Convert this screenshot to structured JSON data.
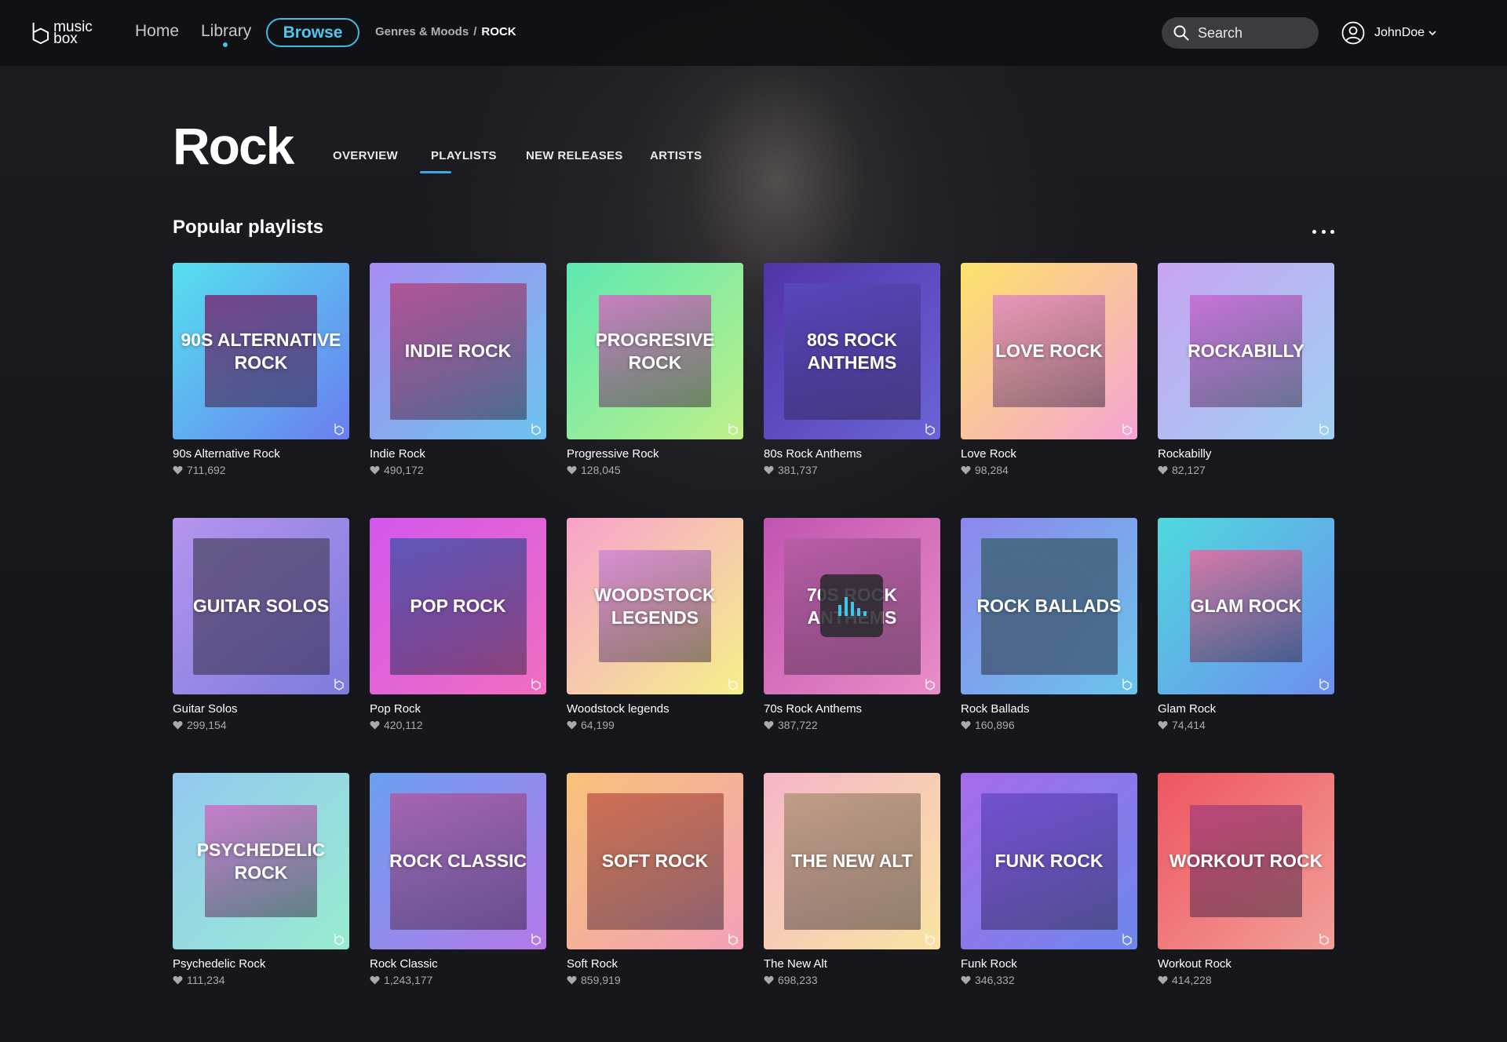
{
  "app": {
    "logo_text": "music box"
  },
  "nav": {
    "home": "Home",
    "library": "Library",
    "browse": "Browse"
  },
  "breadcrumb": {
    "parent": "Genres & Moods",
    "separator": "/",
    "current": "ROCK"
  },
  "search": {
    "placeholder": "Search"
  },
  "user": {
    "name": "JohnDoe"
  },
  "page": {
    "title": "Rock"
  },
  "tabs": [
    "OVERVIEW",
    "PLAYLISTS",
    "NEW RELEASES",
    "ARTISTS"
  ],
  "active_tab": "PLAYLISTS",
  "section": {
    "title": "Popular playlists"
  },
  "colors": {
    "accent": "#3fb9e6",
    "background": "#15171b"
  },
  "playlists": [
    {
      "name": "90s Alternative Rock",
      "cover_title": "90s ALTERNATIVE ROCK",
      "likes": "711,692",
      "grad": [
        "#56e0ef",
        "#6a7ef0"
      ],
      "photo": "#7a2a78"
    },
    {
      "name": "Indie Rock",
      "cover_title": "INDIE ROCK",
      "likes": "490,172",
      "grad": [
        "#a78cf2",
        "#6cc3ef"
      ],
      "photo": "#b44a86"
    },
    {
      "name": "Progressive Rock",
      "cover_title": "PROGRESIVE ROCK",
      "likes": "128,045",
      "grad": [
        "#5de8b0",
        "#bff08a"
      ],
      "photo": "#d96cc6"
    },
    {
      "name": "80s Rock Anthems",
      "cover_title": "80s ROCK ANTHEMS",
      "likes": "381,737",
      "grad": [
        "#5233a8",
        "#6a64d8"
      ],
      "photo": "#5a4ac0"
    },
    {
      "name": "Love Rock",
      "cover_title": "LOVE ROCK",
      "likes": "98,284",
      "grad": [
        "#fde36a",
        "#f5a3d4"
      ],
      "photo": "#e88ac6"
    },
    {
      "name": "Rockabilly",
      "cover_title": "ROCKABILLY",
      "likes": "82,127",
      "grad": [
        "#c8a4f2",
        "#9fd0f2"
      ],
      "photo": "#c66ad4"
    },
    {
      "name": "Guitar Solos",
      "cover_title": "GUITAR SOLOS",
      "likes": "299,154",
      "grad": [
        "#b594ee",
        "#7d7cdc"
      ],
      "photo": "#5b4e78"
    },
    {
      "name": "Pop Rock",
      "cover_title": "POP ROCK",
      "likes": "420,112",
      "grad": [
        "#d357ec",
        "#f06ec0"
      ],
      "photo": "#4b56b0"
    },
    {
      "name": "Woodstock legends",
      "cover_title": "WOODSTOCK LEGENDS",
      "likes": "64,199",
      "grad": [
        "#f8a2cc",
        "#f5f08a"
      ],
      "photo": "#d28ad4"
    },
    {
      "name": "70s Rock Anthems",
      "cover_title": "70s ROCK ANTHEMS",
      "likes": "387,722",
      "grad": [
        "#c154b0",
        "#e98dc8"
      ],
      "photo": "#b75ea6"
    },
    {
      "name": "Rock Ballads",
      "cover_title": "ROCK BALLADS",
      "likes": "160,896",
      "grad": [
        "#8d86ec",
        "#6ac4ec"
      ],
      "photo": "#3e6878"
    },
    {
      "name": "Glam Rock",
      "cover_title": "GLAM ROCK",
      "likes": "74,414",
      "grad": [
        "#4fd9dd",
        "#6f8ef0"
      ],
      "photo": "#ec6aa2"
    },
    {
      "name": "Psychedelic Rock",
      "cover_title": "PSYCHEDELIC ROCK",
      "likes": "111,234",
      "grad": [
        "#94c8f0",
        "#98ecd0"
      ],
      "photo": "#d070c6"
    },
    {
      "name": "Rock Classic",
      "cover_title": "ROCK CLASSIC",
      "likes": "1,243,177",
      "grad": [
        "#6aa0f0",
        "#b678e8"
      ],
      "photo": "#b15aa6"
    },
    {
      "name": "Soft Rock",
      "cover_title": "SOFT ROCK",
      "likes": "859,919",
      "grad": [
        "#f8c27a",
        "#f3a0b6"
      ],
      "photo": "#c8604c"
    },
    {
      "name": "The New Alt",
      "cover_title": "THE NEW ALT",
      "likes": "698,233",
      "grad": [
        "#f5b6c8",
        "#f9e4a2"
      ],
      "photo": "#b7987a"
    },
    {
      "name": "Funk Rock",
      "cover_title": "FUNK ROCK",
      "likes": "346,332",
      "grad": [
        "#a66bea",
        "#6d87ec"
      ],
      "photo": "#6a4bd0"
    },
    {
      "name": "Workout Rock",
      "cover_title": "WORKOUT ROCK",
      "likes": "414,228",
      "grad": [
        "#ef5560",
        "#f0a098"
      ],
      "photo": "#b2447e"
    }
  ]
}
